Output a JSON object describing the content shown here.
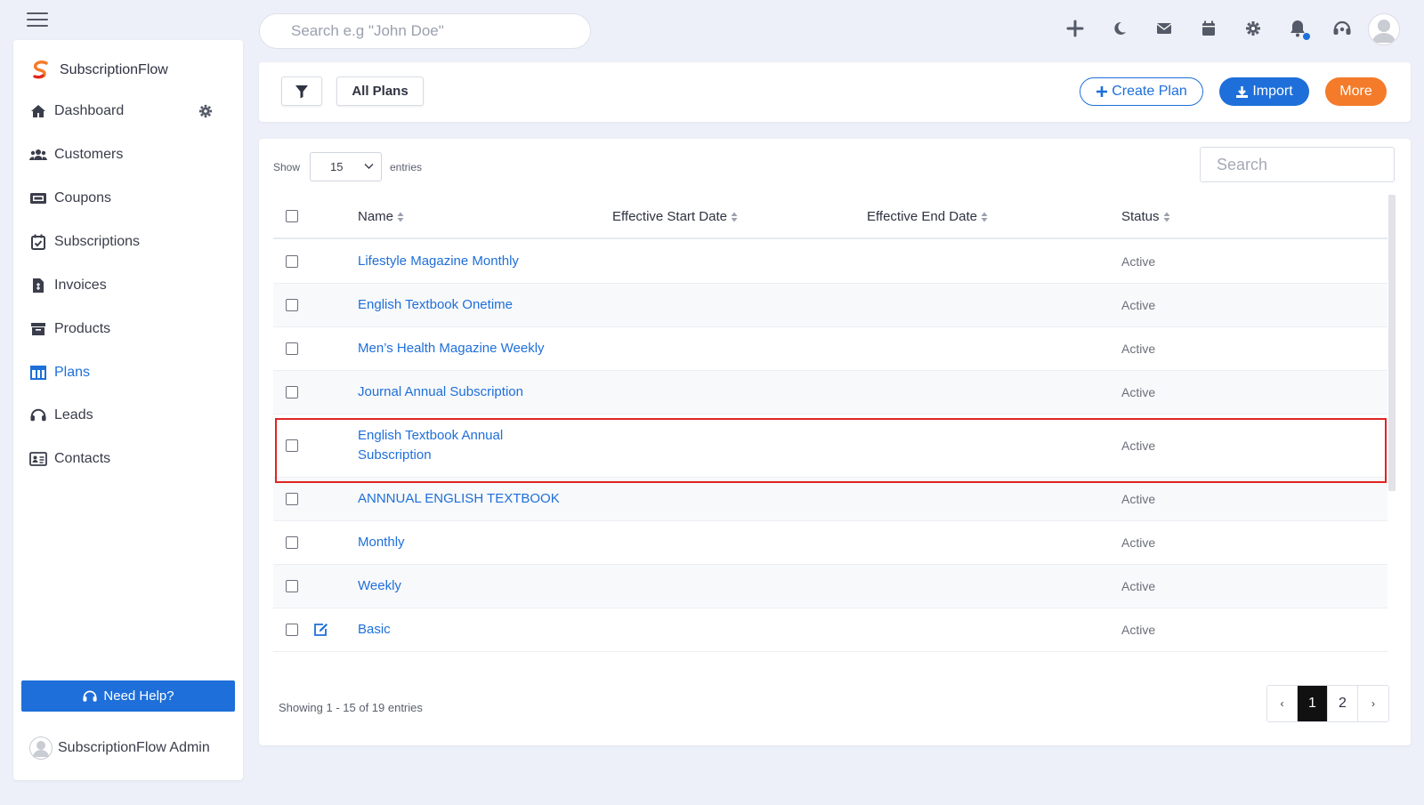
{
  "topbar": {
    "search_placeholder": "Search e.g \"John Doe\"",
    "icons": [
      "plus-icon",
      "moon-icon",
      "mail-icon",
      "calendar-icon",
      "gear-icon",
      "bell-icon",
      "headset-icon",
      "avatar"
    ]
  },
  "sidebar": {
    "brand": "SubscriptionFlow",
    "items": [
      {
        "label": "Dashboard",
        "icon": "home-icon"
      },
      {
        "label": "Customers",
        "icon": "users-icon"
      },
      {
        "label": "Coupons",
        "icon": "ticket-icon"
      },
      {
        "label": "Subscriptions",
        "icon": "calendar-check-icon"
      },
      {
        "label": "Invoices",
        "icon": "invoice-icon"
      },
      {
        "label": "Products",
        "icon": "box-icon"
      },
      {
        "label": "Plans",
        "icon": "table-icon",
        "active": true
      },
      {
        "label": "Leads",
        "icon": "headset-icon"
      },
      {
        "label": "Contacts",
        "icon": "contact-card-icon"
      }
    ],
    "help_label": "Need Help?",
    "admin_name": "SubscriptionFlow Admin"
  },
  "toolbar": {
    "all_plans_label": "All Plans",
    "create_label": "Create Plan",
    "import_label": "Import",
    "more_label": "More"
  },
  "table": {
    "show_label": "Show",
    "entries_value": "15",
    "entries_label": "entries",
    "search_placeholder": "Search",
    "columns": [
      "Name",
      "Effective Start Date",
      "Effective End Date",
      "Status"
    ],
    "rows": [
      {
        "name": "Lifestyle Magazine Monthly",
        "start": "",
        "end": "",
        "status": "Active"
      },
      {
        "name": "English Textbook Onetime",
        "start": "",
        "end": "",
        "status": "Active"
      },
      {
        "name": "Men’s Health Magazine Weekly",
        "start": "",
        "end": "",
        "status": "Active"
      },
      {
        "name": "Journal Annual Subscription",
        "start": "",
        "end": "",
        "status": "Active"
      },
      {
        "name": "English Textbook Annual Subscription",
        "name_line1": "English Textbook Annual",
        "name_line2": "Subscription",
        "start": "",
        "end": "",
        "status": "Active",
        "highlighted": true
      },
      {
        "name": "ANNNUAL ENGLISH TEXTBOOK",
        "start": "",
        "end": "",
        "status": "Active"
      },
      {
        "name": "Monthly",
        "start": "",
        "end": "",
        "status": "Active"
      },
      {
        "name": "Weekly",
        "start": "",
        "end": "",
        "status": "Active"
      },
      {
        "name": "Basic",
        "start": "",
        "end": "",
        "status": "Active",
        "edit_icon": true
      }
    ],
    "showing_text": "Showing 1 - 15 of 19 entries",
    "pagination": {
      "prev": "‹",
      "pages": [
        "1",
        "2"
      ],
      "current": "1",
      "next": "›"
    }
  },
  "colors": {
    "accent": "#1e6fd9",
    "more_button": "#f47b2a",
    "highlight_border": "#e02424",
    "background": "#edf0f8"
  }
}
